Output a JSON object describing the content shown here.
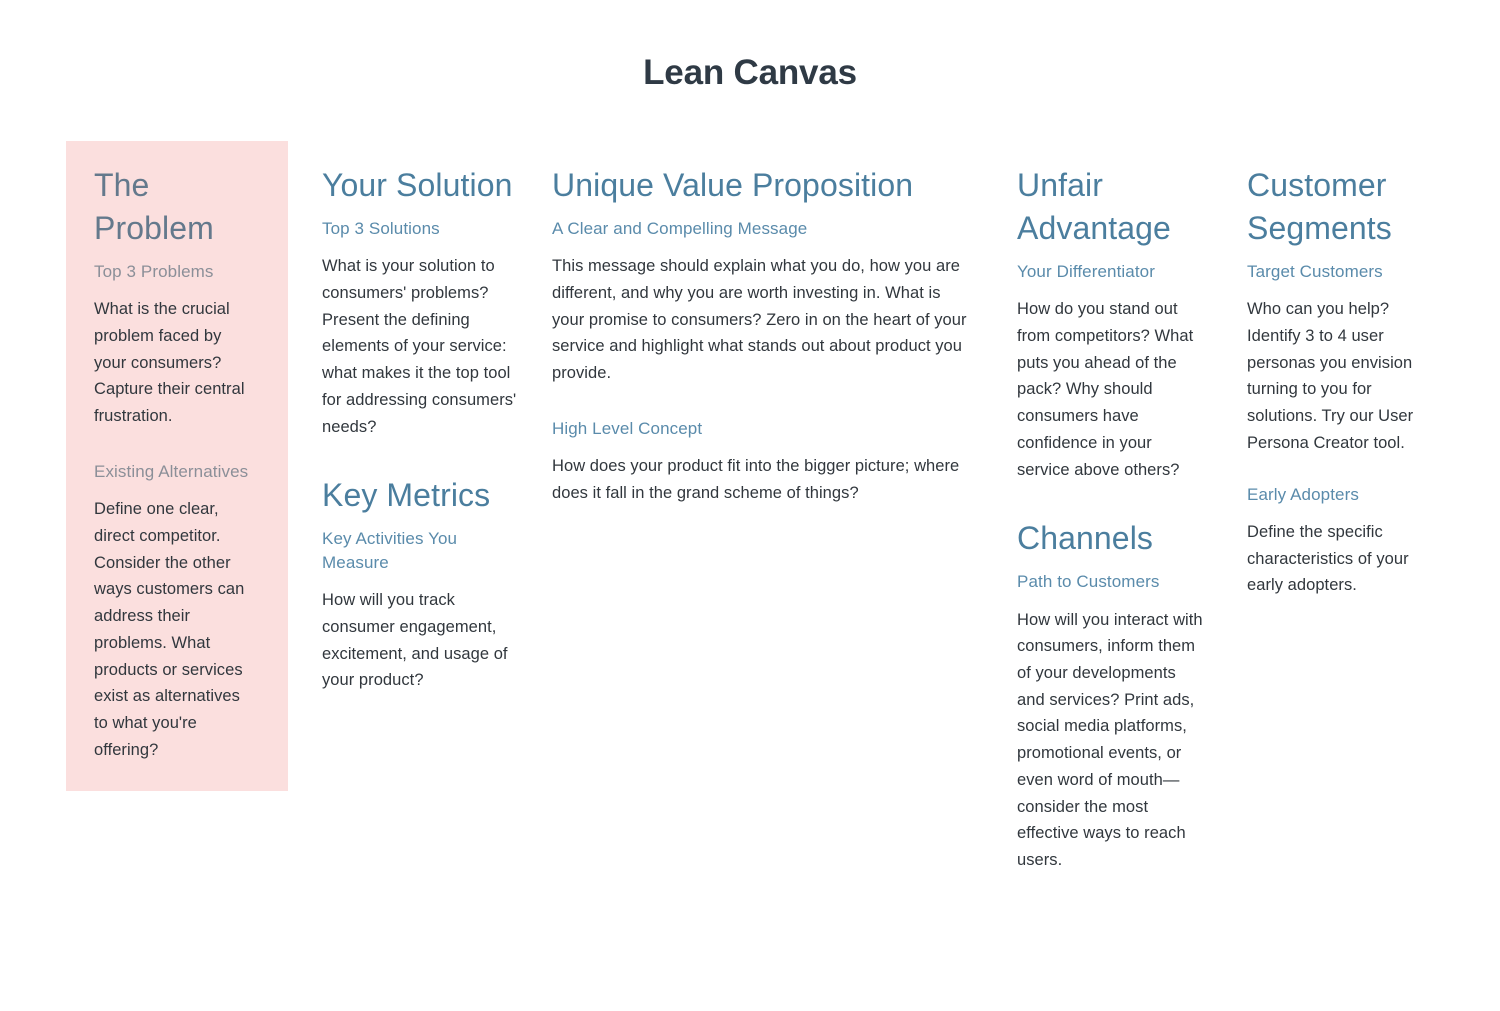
{
  "document": {
    "title": "Lean Canvas",
    "background_color": "#ffffff",
    "heading_color": "#4b7e9e",
    "subheading_color": "#5a8bab",
    "body_color": "#31373d",
    "highlight_panel_color": "#fbdfde",
    "title_color": "#2f3a45"
  },
  "columns": {
    "problem": {
      "title": "The Problem",
      "subtitle": "Top 3 Problems",
      "body": "What is the crucial problem faced by your consumers? Capture their central frustration.",
      "alt_subtitle": "Existing Alternatives",
      "alt_body": "Define one clear, direct competitor. Consider the other ways customers can address their problems. What products or services exist as alternatives to what you're offering?"
    },
    "solution": {
      "title": "Your Solution",
      "subtitle": "Top 3 Solutions",
      "body": "What is your solution to consumers' problems? Present the defining elements of your service: what makes it the top tool for addressing consumers' needs?",
      "metrics_title": "Key Metrics",
      "metrics_subtitle": "Key Activities You Measure",
      "metrics_body": "How will you track consumer engagement, excitement, and usage of your product?"
    },
    "uvp": {
      "title": "Unique Value Proposition",
      "subtitle": "A Clear and Compelling Message",
      "body": "This message should explain what you do, how you are different, and why you are worth investing in. What is your promise to consumers? Zero in on the heart of your service and highlight what stands out about product you provide.",
      "concept_subtitle": "High Level Concept",
      "concept_body": "How does your product fit into the bigger picture; where does it fall in the grand scheme of things?"
    },
    "unfair": {
      "title": "Unfair Advantage",
      "subtitle": "Your Differentiator",
      "body": "How do you stand out from competitors? What puts you ahead of the pack? Why should consumers have confidence in your service above others?",
      "channels_title": "Channels",
      "channels_subtitle": "Path to Customers",
      "channels_body": "How will you interact with consumers, inform them of your developments and services? Print ads, social media platforms, promotional events, or even word of mouth—consider the most effective ways to reach users."
    },
    "segments": {
      "title": "Customer Segments",
      "subtitle": "Target Customers",
      "body": "Who can you help? Identify 3 to 4 user personas you envision turning to you for solutions. Try our User Persona Creator tool.",
      "adopters_subtitle": "Early Adopters",
      "adopters_body": "Define the specific characteristics of your early adopters."
    }
  }
}
